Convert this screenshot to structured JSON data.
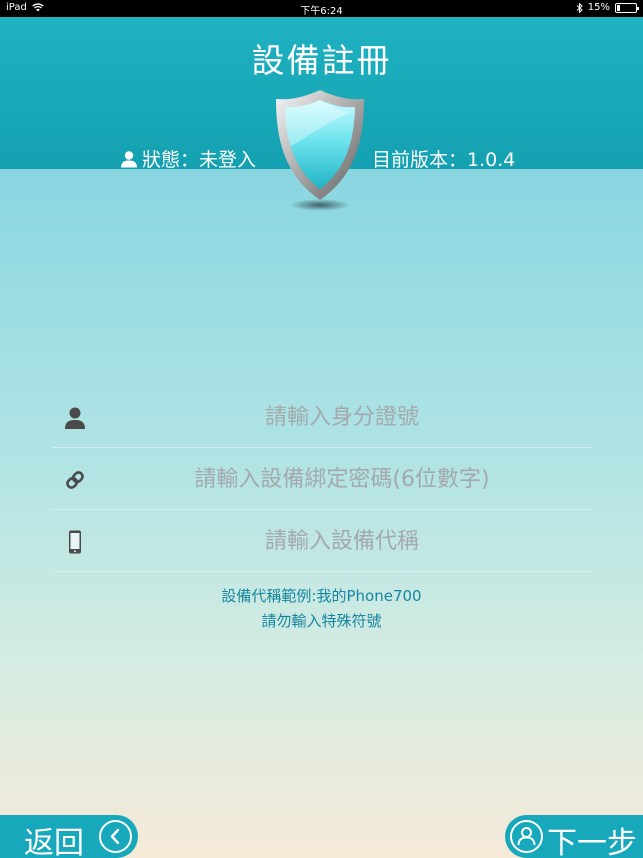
{
  "status_bar": {
    "device": "iPad",
    "time": "下午6:24",
    "battery": "15%",
    "battery_level": 0.15
  },
  "header": {
    "title": "設備註冊",
    "status_label": "狀態：未登入",
    "version_label": "目前版本：1.0.4"
  },
  "form": {
    "id_placeholder": "請輸入身分證號",
    "password_placeholder": "請輸入設備綁定密碼(6位數字)",
    "device_name_placeholder": "請輸入設備代稱"
  },
  "hints": {
    "example": "設備代稱範例:我的Phone700",
    "no_special": "請勿輸入特殊符號"
  },
  "buttons": {
    "back": "返回",
    "next": "下一步"
  }
}
